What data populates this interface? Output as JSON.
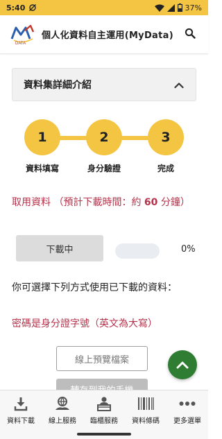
{
  "status_bar": {
    "time": "5:40",
    "battery": "37%"
  },
  "header": {
    "title": "個人化資料自主運用(MyData)",
    "logo_text": "DATA"
  },
  "section": {
    "title": "資料集詳細介紹"
  },
  "steps": [
    {
      "number": "1",
      "label": "資料填寫"
    },
    {
      "number": "2",
      "label": "身分驗證"
    },
    {
      "number": "3",
      "label": "完成"
    }
  ],
  "download": {
    "note_prefix": "取用資料 （預計下載時間：約 ",
    "note_minutes": "60",
    "note_suffix": " 分鐘）",
    "status_label": "下載中",
    "progress_percent": "0%",
    "progress_value": 0
  },
  "usage": {
    "text": "你可選擇下列方式使用已下載的資料：",
    "password_note": "密碼是身分證字號（英文為大寫）",
    "preview_button": "線上預覽檔案",
    "save_button": "轉存到我的手機"
  },
  "bottom_nav": [
    {
      "label": "資料下載",
      "icon": "download-icon"
    },
    {
      "label": "線上服務",
      "icon": "online-service-icon"
    },
    {
      "label": "臨櫃服務",
      "icon": "counter-service-icon"
    },
    {
      "label": "資料條碼",
      "icon": "barcode-icon"
    },
    {
      "label": "更多選單",
      "icon": "more-icon"
    }
  ],
  "colors": {
    "accent": "#f4c542",
    "alert": "#b5324a",
    "fab": "#2e7d32"
  }
}
